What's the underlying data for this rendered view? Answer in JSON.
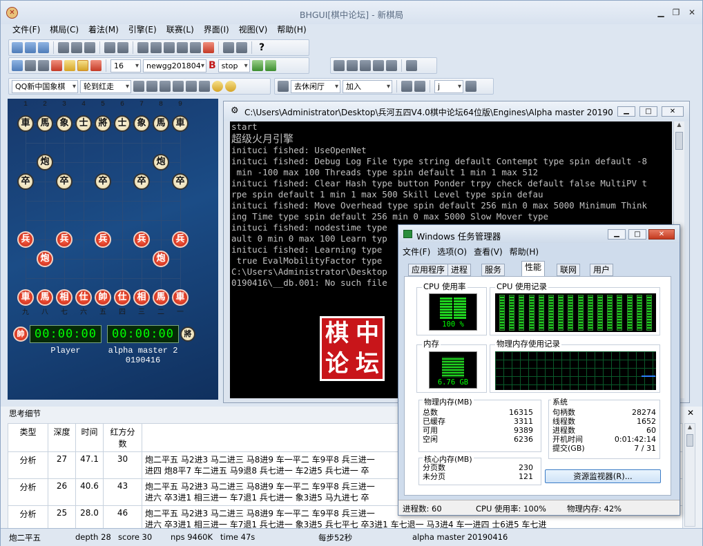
{
  "app": {
    "title": "BHGUI[棋中论坛] - 新棋局"
  },
  "menu": [
    "文件(F)",
    "棋局(C)",
    "着法(M)",
    "引擎(E)",
    "联赛(L)",
    "界面(I)",
    "视图(V)",
    "帮助(H)"
  ],
  "toolbar": {
    "depth_value": "16",
    "book_value": "newgg201804",
    "stop_label": "stop",
    "platform_value": "QQ新中国象棋",
    "turn_value": "轮到红走",
    "room_value": "去休闲厅",
    "join_value": "加入",
    "j_value": "j"
  },
  "board": {
    "black_top": [
      "車",
      "馬",
      "象",
      "士",
      "將",
      "士",
      "象",
      "馬",
      "車"
    ],
    "black_cannon": "炮",
    "black_soldier": "卒",
    "red_soldier": "兵",
    "red_cannon": "炮",
    "red_back": [
      "車",
      "馬",
      "相",
      "仕",
      "帥",
      "仕",
      "相",
      "馬",
      "車"
    ],
    "red_king_icon": "帥",
    "black_king_icon": "將",
    "clock_left": "00:00:00",
    "clock_right": "00:00:00",
    "player_left": "Player",
    "player_right_l1": "alpha master 2",
    "player_right_l2": "0190416",
    "file_top": [
      "1",
      "2",
      "3",
      "4",
      "5",
      "6",
      "7",
      "8",
      "9"
    ],
    "file_bottom": [
      "九",
      "八",
      "七",
      "六",
      "五",
      "四",
      "三",
      "二",
      "一"
    ]
  },
  "console": {
    "title": "C:\\Users\\Administrator\\Desktop\\兵河五四V4.0棋中论坛64位版\\Engines\\Alpha master 20190...",
    "lines": [
      "start",
      "超级火月引擎",
      "inituci fished: UseOpenNet",
      "inituci fished: Debug Log File type string default Contempt type spin default -8",
      " min -100 max 100 Threads type spin default 1 min 1 max 512",
      "inituci fished: Clear Hash type button Ponder trpy check default false MultiPV t",
      "rpe spin default 1 min 1 max 500 Skill Level type spin defau",
      "inituci fished: Move Overhead type spin default 256 min 0 max 5000 Minimum Think",
      "ing Time type spin default 256 min 0 max 5000 Slow Mover type",
      "inituci fished: nodestime type",
      "ault 0 min 0 max 100 Learn typ",
      "inituci fished: Learning type",
      " true EvalMobilityFactor type",
      "C:\\Users\\Administrator\\Desktop",
      "0190416\\__db.001: No such file"
    ],
    "seal": [
      "中",
      "坛",
      "棋",
      "论"
    ]
  },
  "taskmgr": {
    "title": "Windows 任务管理器",
    "menu": [
      "文件(F)",
      "选项(O)",
      "查看(V)",
      "帮助(H)"
    ],
    "tabs": [
      "应用程序",
      "进程",
      "服务",
      "性能",
      "联网",
      "用户"
    ],
    "cpu_label": "CPU 使用率",
    "cpu_value": "100 %",
    "cpu_hist_label": "CPU 使用记录",
    "mem_label": "内存",
    "mem_value": "6.76 GB",
    "mem_hist_label": "物理内存使用记录",
    "phys_title": "物理内存(MB)",
    "phys": [
      [
        "总数",
        "16315"
      ],
      [
        "已缓存",
        "3311"
      ],
      [
        "可用",
        "9389"
      ],
      [
        "空闲",
        "6236"
      ]
    ],
    "sys_title": "系统",
    "sys": [
      [
        "句柄数",
        "28274"
      ],
      [
        "线程数",
        "1652"
      ],
      [
        "进程数",
        "60"
      ],
      [
        "开机时间",
        "0:01:42:14"
      ],
      [
        "提交(GB)",
        "7 / 31"
      ]
    ],
    "kernel_title": "核心内存(MB)",
    "kernel": [
      [
        "分页数",
        "230"
      ],
      [
        "未分页",
        "121"
      ]
    ],
    "resmon_button": "资源监视器(R)...",
    "status": [
      "进程数: 60",
      "CPU 使用率: 100%",
      "物理内存: 42%"
    ]
  },
  "think": {
    "title": "思考细节",
    "headers": [
      "类型",
      "深度",
      "时间",
      "红方分数"
    ],
    "rows": [
      {
        "type": "分析",
        "depth": "27",
        "time": "47.1",
        "score": "30",
        "pv1": "炮二平五 马2进3 马二进三 马8进9 车一平二 车9平8 兵三进一",
        "pv2": "进四 炮8平7 车二进五 马9退8 兵七进一 车2进5 兵七进一 卒"
      },
      {
        "type": "分析",
        "depth": "26",
        "time": "40.6",
        "score": "43",
        "pv1": "炮二平五 马2进3 马二进三 马8进9 车一平二 车9平8 兵三进一",
        "pv2": "进六 卒3进1 相三进一 车7退1 兵七进一 象3进5 马九进七 卒"
      },
      {
        "type": "分析",
        "depth": "25",
        "time": "28.0",
        "score": "46",
        "pv1": "炮二平五 马2进3 马二进三 马8进9 车一平二 车9平8 兵三进一",
        "pv2": "进六 卒3进1 相三进一 车7退1 兵七进一 象3进5 兵七平七 卒3进1 车七退一 马3进4 车一进四 士6进5 车七进"
      }
    ]
  },
  "status": {
    "move": "炮二平五",
    "depth": "depth 28",
    "score": "score 30",
    "nps": "nps 9460K",
    "time": "time 47s",
    "per_step": "每步52秒",
    "engine": "alpha master 20190416"
  }
}
